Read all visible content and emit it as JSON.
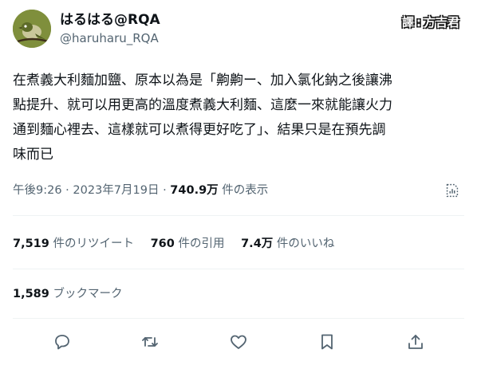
{
  "author": {
    "display_name": "はるはる@RQA",
    "handle": "@haruharu_RQA"
  },
  "translator": {
    "prefix": "譯",
    "separator": ":",
    "name": "方吉君"
  },
  "tweet": {
    "lines": [
      "在煮義大利麵加鹽、原本以為是「齁齁ー、加入氯化鈉之後讓沸",
      "點提升、就可以用更高的溫度煮義大利麵、這麼一來就能讓火力",
      "通到麵心裡去、這樣就可以煮得更好吃了」、結果只是在預先調",
      "味而已"
    ]
  },
  "meta": {
    "time": "午後9:26",
    "dot": "·",
    "date": "2023年7月19日",
    "views_count": "740.9万",
    "views_label": "件の表示"
  },
  "stats": {
    "retweets_count": "7,519",
    "retweets_label": "件のリツイート",
    "quotes_count": "760",
    "quotes_label": "件の引用",
    "likes_count": "7.4万",
    "likes_label": "件のいいね"
  },
  "bookmarks": {
    "count": "1,589",
    "label": "ブックマーク"
  },
  "actions": [
    "reply-icon",
    "retweet-icon",
    "like-icon",
    "bookmark-icon",
    "share-icon"
  ],
  "colors": {
    "text": "#0f1419",
    "secondary": "#536471",
    "divider": "#eff3f4",
    "avatar_bg": "#7f8f3c"
  }
}
